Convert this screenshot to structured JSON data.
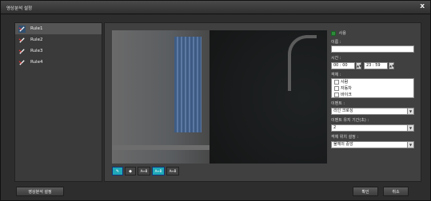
{
  "window": {
    "title": "영상분석 설정",
    "close_label": "x"
  },
  "rules": [
    {
      "label": "Rule1",
      "selected": true
    },
    {
      "label": "Rule2",
      "selected": false
    },
    {
      "label": "Rule3",
      "selected": false
    },
    {
      "label": "Rule4",
      "selected": false
    }
  ],
  "toolbar": {
    "btn1": "✎",
    "btn2": "◆",
    "btn3": "A↔B",
    "btn4": "A↔B",
    "btn5": "A↔B"
  },
  "props": {
    "use_label": "사용",
    "name_label": "이름 :",
    "name_value": "",
    "time_label": "시간 :",
    "time_start": "00 : 00",
    "time_end": "23 : 59",
    "object_label": "객체 :",
    "objects": [
      "사람",
      "자동차",
      "바이크"
    ],
    "event_label": "이벤트 :",
    "event_value": "라인 크로싱",
    "duration_label": "이벤트 유지 기간(초) :",
    "duration_value": "2",
    "position_label": "객체 위치 설정 :",
    "position_value": "물체의 중앙"
  },
  "buttons": {
    "analysis_settings": "영상분석 설정",
    "ok": "확인",
    "cancel": "취소"
  }
}
